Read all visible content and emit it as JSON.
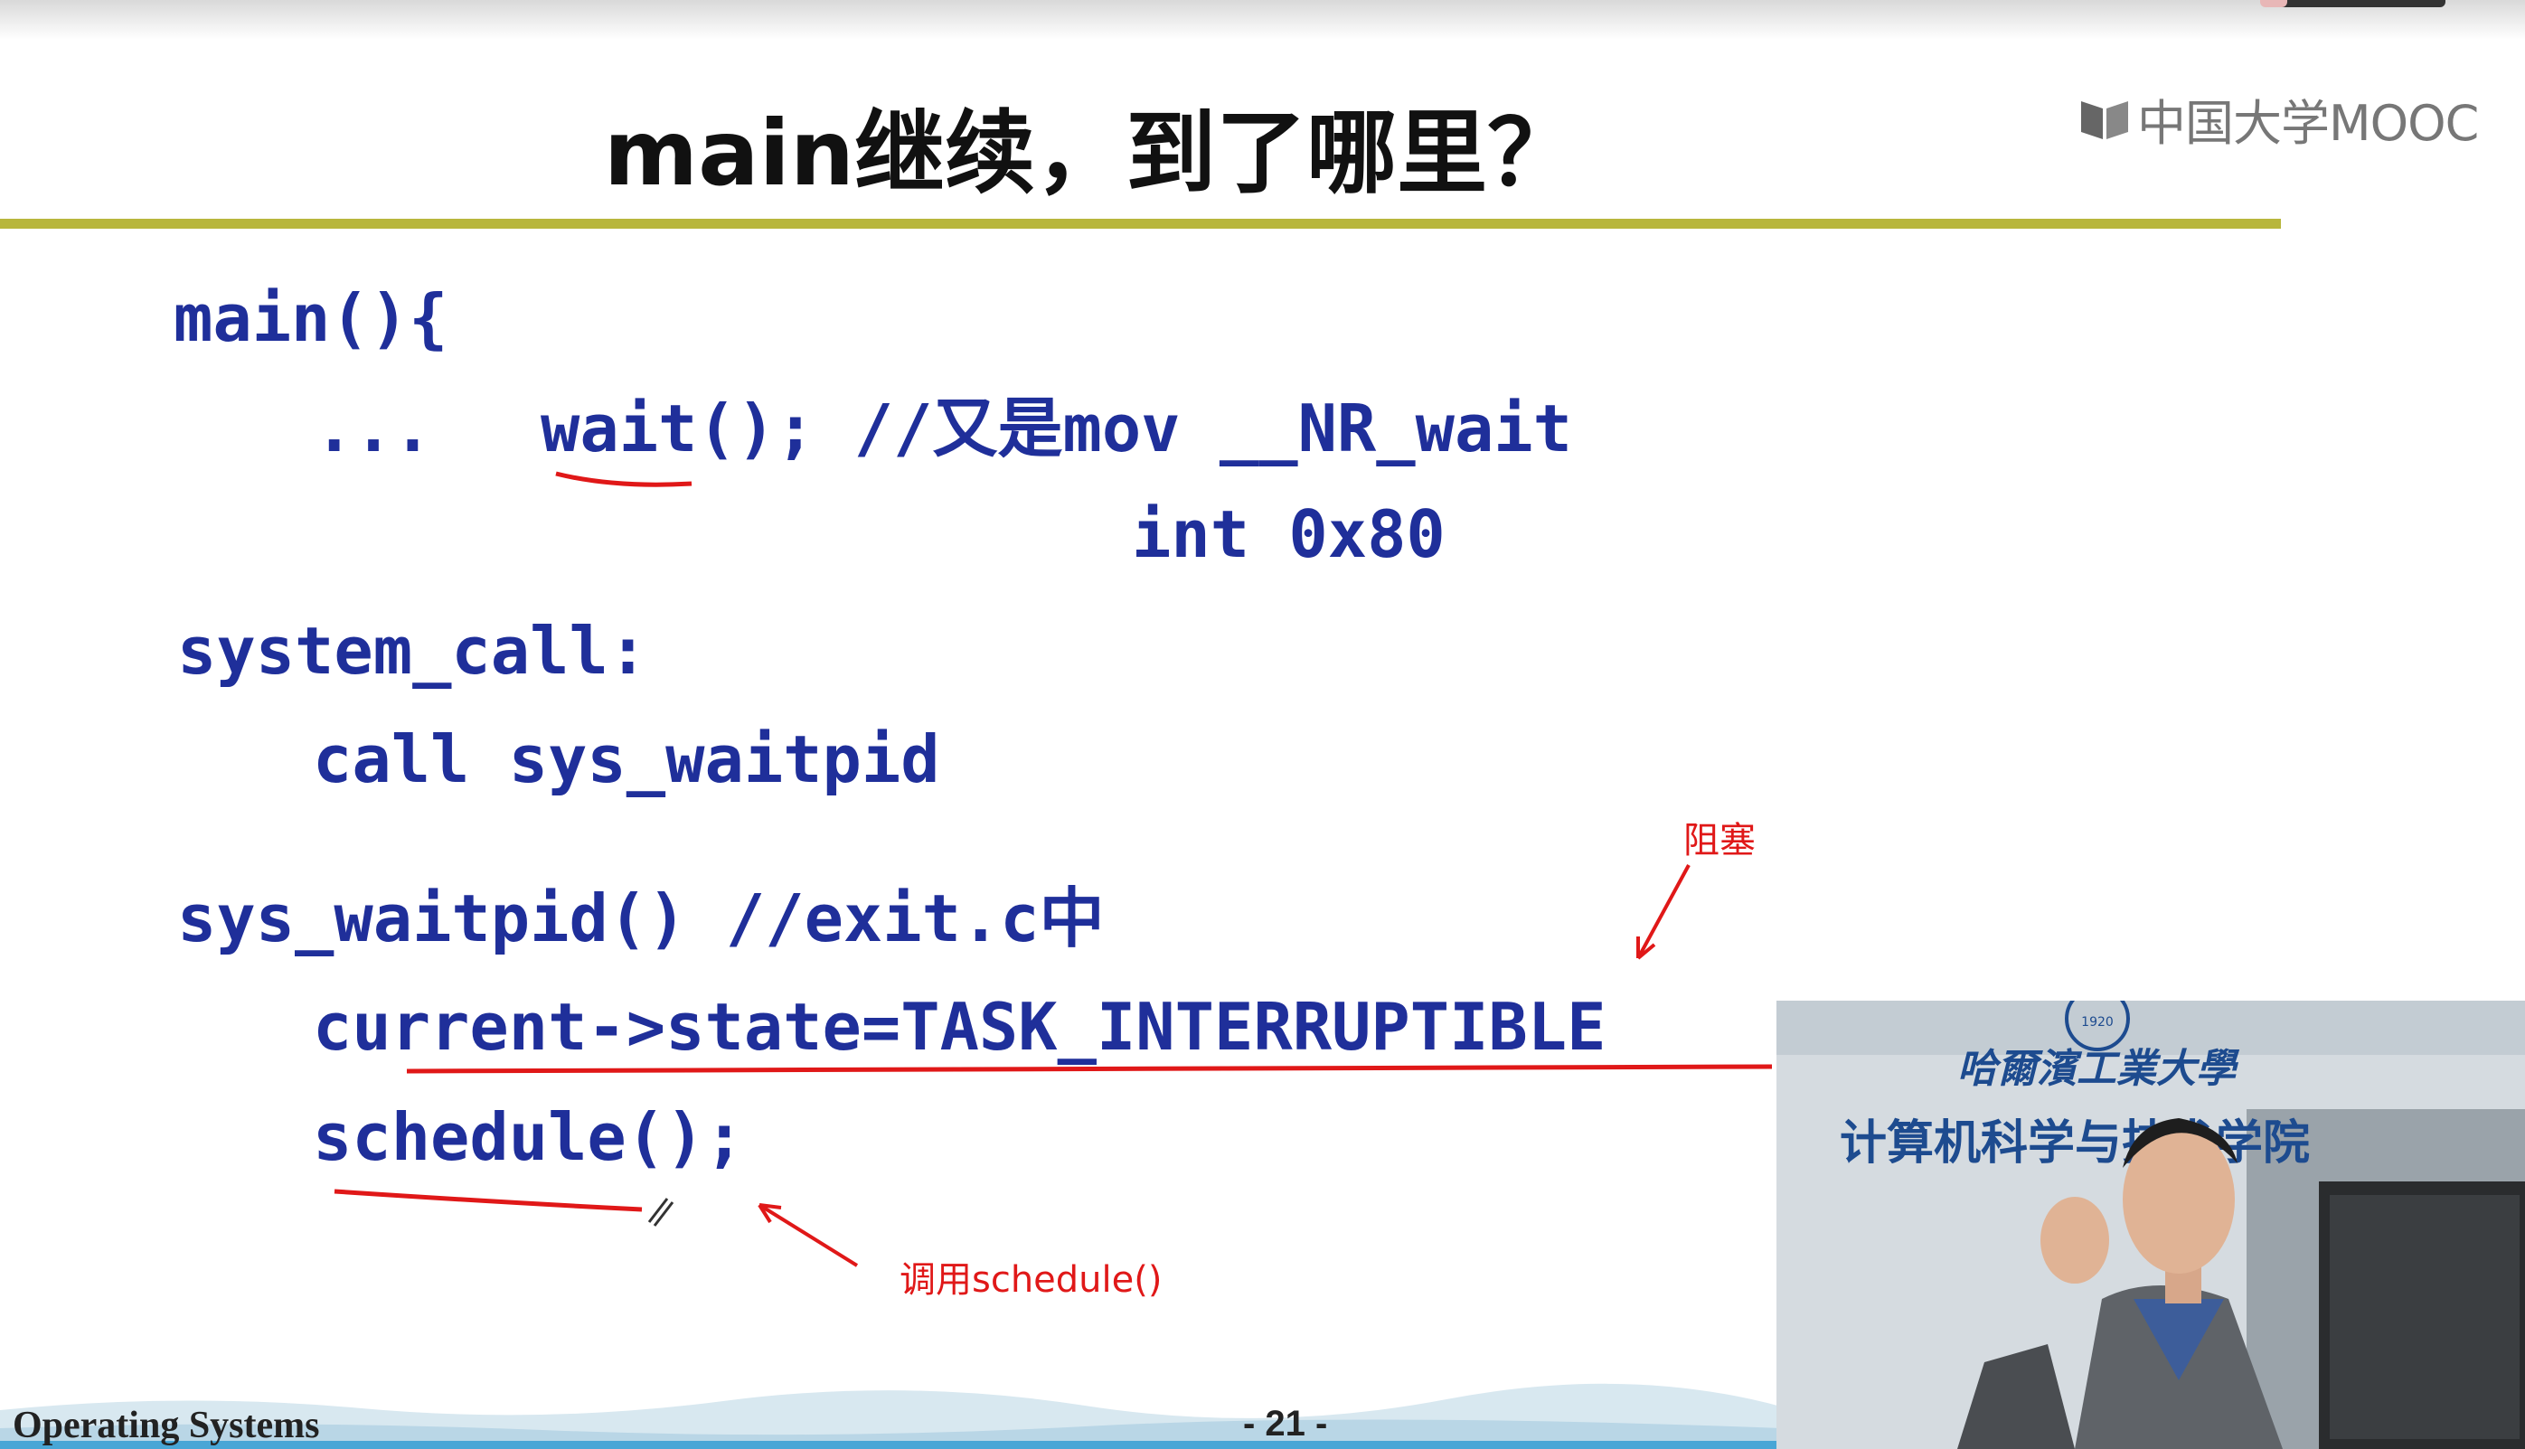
{
  "slide": {
    "title": "main继续，到了哪里？",
    "brand": "中国大学MOOC",
    "code": {
      "line1": "main(){",
      "line2a": "...",
      "line2b": "wait(); //又是mov __NR_wait",
      "line3": "int 0x80",
      "line4": "system_call:",
      "line5": "call sys_waitpid",
      "line6": "sys_waitpid() //exit.c中",
      "line7": "current->state=TASK_INTERRUPTIBLE",
      "line8": "schedule();"
    },
    "annotations": {
      "blocked": "阻塞",
      "call_schedule": "调用schedule()"
    },
    "footer": {
      "course": "Operating Systems",
      "page": "- 21 -"
    }
  },
  "video_overlay": {
    "wall_text_line1": "哈爾濱工業大學",
    "wall_text_line2": "计算机科学与技术学院",
    "emblem_year": "1920"
  },
  "colors": {
    "code": "#1f2f9a",
    "rule": "#b8b63c",
    "annotation": "#e01818",
    "title": "#111111"
  }
}
